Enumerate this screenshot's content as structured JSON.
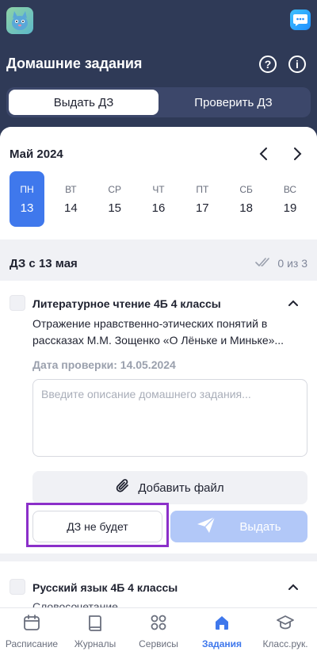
{
  "header": {
    "title": "Домашние задания",
    "logo_icon": "cat-logo-icon",
    "chat_icon": "chat-icon",
    "help_icon": "question-circle-icon",
    "info_icon": "info-circle-icon",
    "help_glyph": "?",
    "info_glyph": "i"
  },
  "tabs": [
    {
      "label": "Выдать ДЗ",
      "active": true
    },
    {
      "label": "Проверить ДЗ",
      "active": false
    }
  ],
  "calendar": {
    "month": "Май 2024",
    "days": [
      {
        "dow": "ПН",
        "num": "13",
        "selected": true
      },
      {
        "dow": "ВТ",
        "num": "14"
      },
      {
        "dow": "СР",
        "num": "15"
      },
      {
        "dow": "ЧТ",
        "num": "16"
      },
      {
        "dow": "ПТ",
        "num": "17"
      },
      {
        "dow": "СБ",
        "num": "18"
      },
      {
        "dow": "ВС",
        "num": "19"
      }
    ]
  },
  "section": {
    "title": "ДЗ с 13 мая",
    "progress": "0 из 3"
  },
  "card1": {
    "subject": "Литературное чтение 4Б 4 классы",
    "topic": "Отражение нравственно-этических понятий в рассказах М.М. Зощенко «О Лёньке и Миньке»...",
    "check_date": "Дата проверки: 14.05.2024",
    "input_placeholder": "Введите описание домашнего задания...",
    "add_file_label": "Добавить файл",
    "no_hw_label": "ДЗ не будет",
    "issue_label": "Выдать"
  },
  "card2": {
    "subject": "Русский язык 4Б 4 классы",
    "topic": "Словосочетание"
  },
  "bottom_nav": [
    {
      "label": "Расписание",
      "icon": "calendar-icon",
      "active": false
    },
    {
      "label": "Журналы",
      "icon": "book-icon",
      "active": false
    },
    {
      "label": "Сервисы",
      "icon": "grid-icon",
      "active": false
    },
    {
      "label": "Задания",
      "icon": "home-icon",
      "active": true
    },
    {
      "label": "Класс.рук.",
      "icon": "graduation-cap-icon",
      "active": false
    }
  ],
  "colors": {
    "header_bg": "#2f3a57",
    "accent": "#3f78ec",
    "highlight": "#8b2fc9"
  }
}
